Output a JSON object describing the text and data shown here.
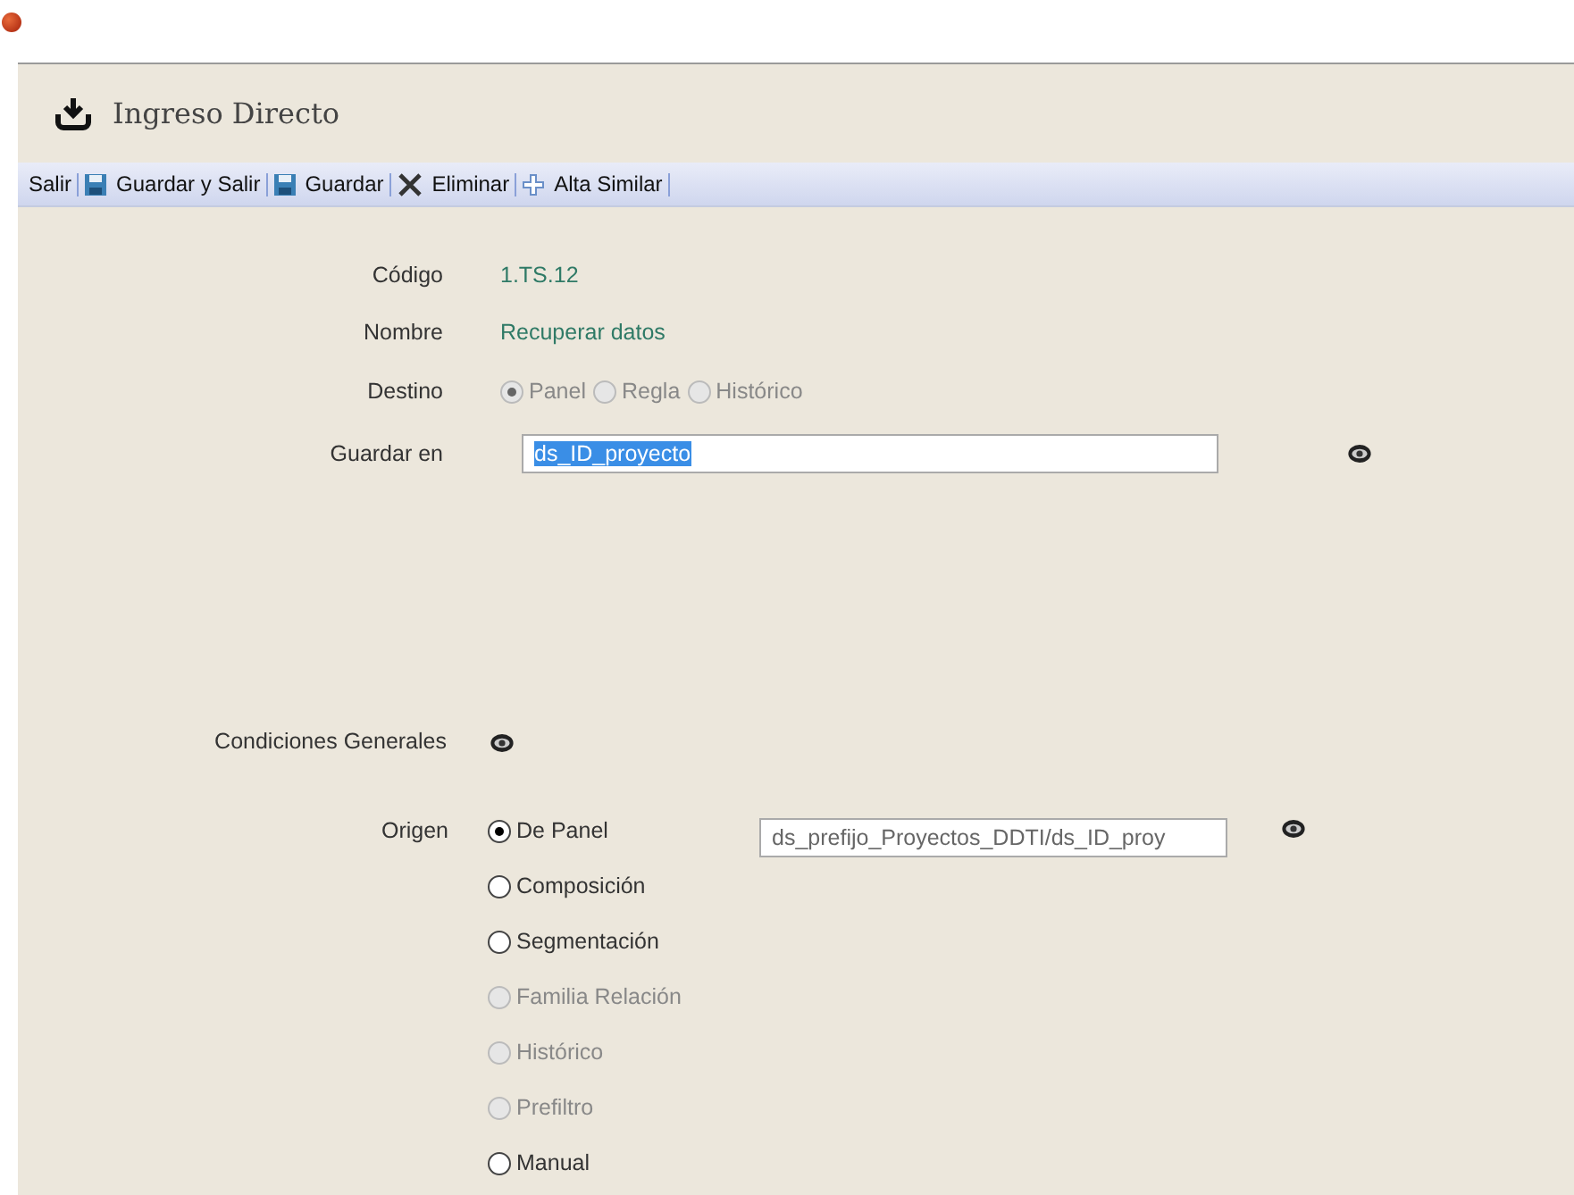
{
  "window": {
    "title": "Ingreso Directo"
  },
  "toolbar": [
    {
      "label": "Salir",
      "kind": "text"
    },
    {
      "label": "Guardar y Salir",
      "kind": "save"
    },
    {
      "label": "Guardar",
      "kind": "save"
    },
    {
      "label": "Eliminar",
      "kind": "delete"
    },
    {
      "label": "Alta Similar",
      "kind": "add"
    }
  ],
  "fields": [
    {
      "label": "Código",
      "value": "1.TS.12"
    },
    {
      "label": "Nombre",
      "value": "Recuperar datos"
    }
  ],
  "destino": {
    "label": "Destino",
    "options": [
      {
        "label": "Panel",
        "selected": true,
        "disabled": true
      },
      {
        "label": "Regla",
        "selected": false,
        "disabled": true
      },
      {
        "label": "Histórico",
        "selected": false,
        "disabled": true
      }
    ]
  },
  "guardar_en": {
    "label": "Guardar en",
    "value": "ds_ID_proyecto"
  },
  "condiciones": {
    "label": "Condiciones Generales"
  },
  "origen": {
    "label": "Origen",
    "value": "ds_prefijo_Proyectos_DDTI/ds_ID_proy",
    "options": [
      {
        "label": "De Panel",
        "selected": true,
        "disabled": false
      },
      {
        "label": "Composición",
        "selected": false,
        "disabled": false
      },
      {
        "label": "Segmentación",
        "selected": false,
        "disabled": false
      },
      {
        "label": "Familia Relación",
        "selected": false,
        "disabled": true
      },
      {
        "label": "Histórico",
        "selected": false,
        "disabled": true
      },
      {
        "label": "Prefiltro",
        "selected": false,
        "disabled": true
      },
      {
        "label": "Manual",
        "selected": false,
        "disabled": false
      }
    ]
  }
}
